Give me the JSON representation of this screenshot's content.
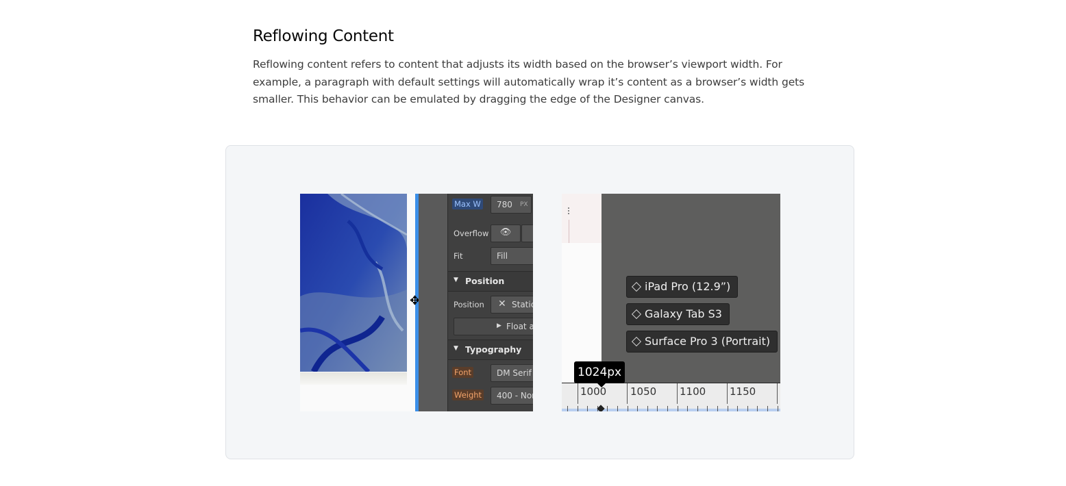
{
  "section": {
    "title": "Reflowing Content",
    "description": "Reflowing content refers to content that adjusts its width based on the browser’s viewport width. For example, a paragraph with default settings will automatically wrap it’s content as a browser’s width gets smaller. This behavior can be emulated by dragging the edge of the Designer canvas."
  },
  "designer_panel": {
    "max_w_label": "Max W",
    "max_w_value": "780",
    "max_w_unit": "PX",
    "overflow_label": "Overflow",
    "fit_label": "Fit",
    "fit_value": "Fill",
    "position_section": "Position",
    "position_label": "Position",
    "position_value": "Static",
    "float_label": "Float a",
    "typography_section": "Typography",
    "font_label": "Font",
    "font_value": "DM Serif D",
    "weight_label": "Weight",
    "weight_value": "400 - Nor"
  },
  "breakpoints": {
    "devices": [
      "iPad Pro (12.9”)",
      "Galaxy Tab S3",
      "Surface Pro 3 (Portrait)"
    ],
    "tooltip": "1024px",
    "ruler_labels": [
      "1000",
      "1050",
      "1100",
      "1150"
    ]
  },
  "colors": {
    "accent_blue": "#3b8fe8",
    "card_bg": "#f4f6f8",
    "panel_bg": "#404040"
  }
}
